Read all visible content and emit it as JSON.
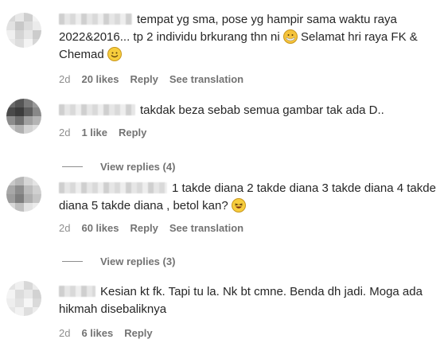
{
  "comments": [
    {
      "text": "tempat yg sma, pose yg hampir sama waktu raya 2022&2016... tp 2 individu brkurang thn ni",
      "text_after_emoji1": " Selamat hri raya FK & Chemad",
      "emoji1": "face-with-medical-mask-emoji",
      "emoji2": "smiling-face-emoji",
      "time": "2d",
      "likes": "20 likes",
      "reply": "Reply",
      "translate": "See translation"
    },
    {
      "text": "takdak beza sebab semua gambar tak ada D..",
      "time": "2d",
      "likes": "1 like",
      "reply": "Reply"
    },
    {
      "text": "1 takde diana 2 takde diana 3 takde diana 4 takde diana 5 takde diana , betol kan?",
      "emoji1": "laughing-face-emoji",
      "time": "2d",
      "likes": "60 likes",
      "reply": "Reply",
      "translate": "See translation"
    },
    {
      "text": "Kesian kt fk. Tapi tu la. Nk bt cmne. Benda dh jadi. Moga ada hikmah disebaliknya",
      "time": "2d",
      "likes": "6 likes",
      "reply": "Reply"
    }
  ],
  "view_replies": [
    "View replies (4)",
    "View replies (3)"
  ],
  "avatar_colors": [
    [
      "#d8d8d8",
      "#e8e8e8",
      "#cfcfcf",
      "#f2f2f2",
      "#e2e2e2",
      "#c8c8c8",
      "#dcdcdc",
      "#ebebeb",
      "#f0f0f0",
      "#d4d4d4",
      "#e6e6e6",
      "#cccccc",
      "#e9e9e9",
      "#dddddd",
      "#f4f4f4",
      "#d6d6d6"
    ],
    [
      "#6b6b6b",
      "#555555",
      "#7a7a7a",
      "#9a9a9a",
      "#4a4a4a",
      "#3c3c3c",
      "#5e5e5e",
      "#888888",
      "#8c8c8c",
      "#6e6e6e",
      "#a0a0a0",
      "#b4b4b4",
      "#c6c6c6",
      "#b0b0b0",
      "#d2d2d2",
      "#dedede"
    ],
    [
      "#c9c9c9",
      "#b7b7b7",
      "#d6d6d6",
      "#e4e4e4",
      "#a8a8a8",
      "#8d8d8d",
      "#bcbcbc",
      "#d0d0d0",
      "#9c9c9c",
      "#7e7e7e",
      "#aeaeae",
      "#c4c4c4",
      "#d8d8d8",
      "#bfbfbf",
      "#e2e2e2",
      "#ececec"
    ],
    [
      "#e4e4e4",
      "#f0f0f0",
      "#d8d8d8",
      "#ebebeb",
      "#f4f4f4",
      "#dcdcdc",
      "#e8e8e8",
      "#d2d2d2",
      "#eeeeee",
      "#e2e2e2",
      "#f6f6f6",
      "#dadada",
      "#e6e6e6",
      "#f2f2f2",
      "#dedede",
      "#ececec"
    ]
  ]
}
